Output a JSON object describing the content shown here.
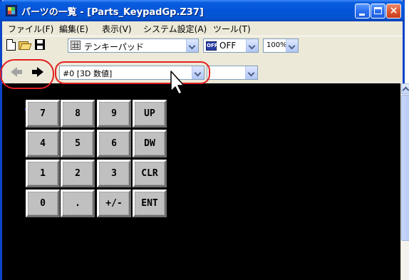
{
  "window": {
    "title": "パーツの一覧 - [Parts_KeypadGp.Z37]",
    "close_glyph": "×"
  },
  "menu": {
    "items": [
      "ファイル(F)",
      "編集(E)",
      "表示(V)",
      "システム設定(A)",
      "ツール(T)"
    ]
  },
  "toolbar": {
    "parts_combo_value": "テンキーパッド",
    "off_icon_text": "OFF",
    "off_combo_value": "OFF",
    "zoom_combo_value": "100%"
  },
  "navbar": {
    "item_combo_value": "#0 [3D 数値]",
    "second_combo_value": ""
  },
  "keypad": {
    "keys": [
      "7",
      "8",
      "9",
      "UP",
      "4",
      "5",
      "6",
      "DW",
      "1",
      "2",
      "3",
      "CLR",
      "0",
      ".",
      "+/-",
      "ENT"
    ]
  },
  "colors": {
    "titlebar": "#0554d8",
    "highlight": "#e42020",
    "canvas": "#000000",
    "key_face": "#c0c0c0"
  }
}
